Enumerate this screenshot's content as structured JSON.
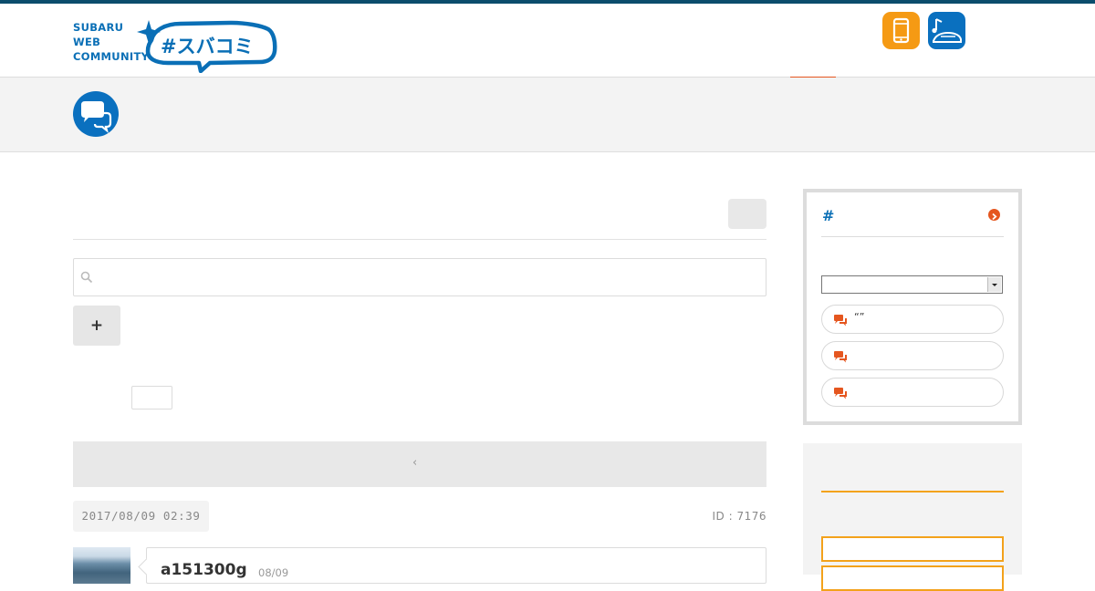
{
  "brand": {
    "logo_text_lines": [
      "SUBARU",
      "WEB",
      "COMMUNITY"
    ],
    "logo_tag": "#スバコミ",
    "primary_color": "#0a6fb6",
    "accent_color": "#e5561f"
  },
  "header": {
    "nav_icons": [
      {
        "icon": "smartphone-icon",
        "color": "#f59a14"
      },
      {
        "icon": "car-music-icon",
        "color": "#0a70bf"
      }
    ]
  },
  "band": {
    "icon": "chat-bubbles-icon"
  },
  "main": {
    "search": {
      "placeholder": "",
      "value": ""
    },
    "add_button_label": "+",
    "pager": {
      "prev_label": "‹"
    },
    "post": {
      "date": "2017/08/09 02:39",
      "id_label": "ID : 7176",
      "username": "a151300g",
      "short_date": "08/09"
    }
  },
  "sidebar": {
    "hashtag_title": "#",
    "select_value": "",
    "pills": [
      {
        "icon": "chat-icon",
        "label": "“”"
      },
      {
        "icon": "chat-icon",
        "label": ""
      },
      {
        "icon": "chat-icon",
        "label": ""
      }
    ]
  }
}
